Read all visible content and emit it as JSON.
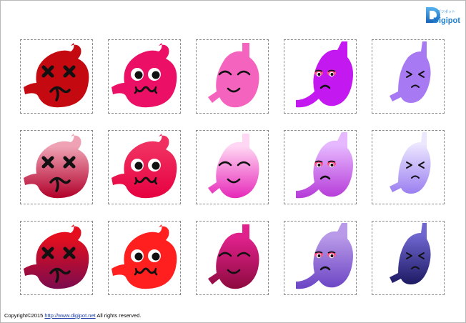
{
  "logo": {
    "text": "Digipot",
    "subtext": "デジポット",
    "color": "#1f7fd0"
  },
  "footer": {
    "prefix": "Copyright©2015 ",
    "link": "http://www.digipot.net",
    "suffix": " All rights reserved."
  },
  "gallery": {
    "rows": [
      [
        {
          "icon": "stomach-dizzy-icon",
          "face": "dizzy",
          "fill": "#c40a10",
          "fill2": "#c40a10"
        },
        {
          "icon": "stomach-bulging-icon",
          "face": "bulge",
          "fill": "#ec0f66",
          "fill2": "#ec0f66"
        },
        {
          "icon": "stomach-happy-icon",
          "face": "happy",
          "fill": "#f463bd",
          "fill2": "#f463bd"
        },
        {
          "icon": "stomach-sad-icon",
          "face": "sad",
          "fill": "#c418f0",
          "fill2": "#c418f0"
        },
        {
          "icon": "stomach-pained-icon",
          "face": "pain",
          "fill": "#a77af4",
          "fill2": "#a77af4"
        }
      ],
      [
        {
          "icon": "stomach-dizzy-icon",
          "face": "dizzy",
          "fill": "#efa2b4",
          "fill2": "#b1002a"
        },
        {
          "icon": "stomach-bulging-icon",
          "face": "bulge",
          "fill": "#f03060",
          "fill2": "#e60040"
        },
        {
          "icon": "stomach-happy-icon",
          "face": "happy",
          "fill": "#ffd6f3",
          "fill2": "#e629b9"
        },
        {
          "icon": "stomach-sad-icon",
          "face": "sad",
          "fill": "#e6b8ff",
          "fill2": "#b53ad8"
        },
        {
          "icon": "stomach-pained-icon",
          "face": "pain",
          "fill": "#ece6ff",
          "fill2": "#9a7ff0"
        }
      ],
      [
        {
          "icon": "stomach-dizzy-icon",
          "face": "dizzy",
          "fill": "#e40e1e",
          "fill2": "#7b0b4e"
        },
        {
          "icon": "stomach-bulging-icon",
          "face": "bulge",
          "fill": "#ff1f1f",
          "fill2": "#ff1f1f"
        },
        {
          "icon": "stomach-happy-icon",
          "face": "happy",
          "fill": "#e0218c",
          "fill2": "#8d0a3e"
        },
        {
          "icon": "stomach-sad-icon",
          "face": "sad",
          "fill": "#b99ae8",
          "fill2": "#6a44c4"
        },
        {
          "icon": "stomach-pained-icon",
          "face": "pain",
          "fill": "#6f66cf",
          "fill2": "#1d1a63"
        }
      ]
    ]
  }
}
